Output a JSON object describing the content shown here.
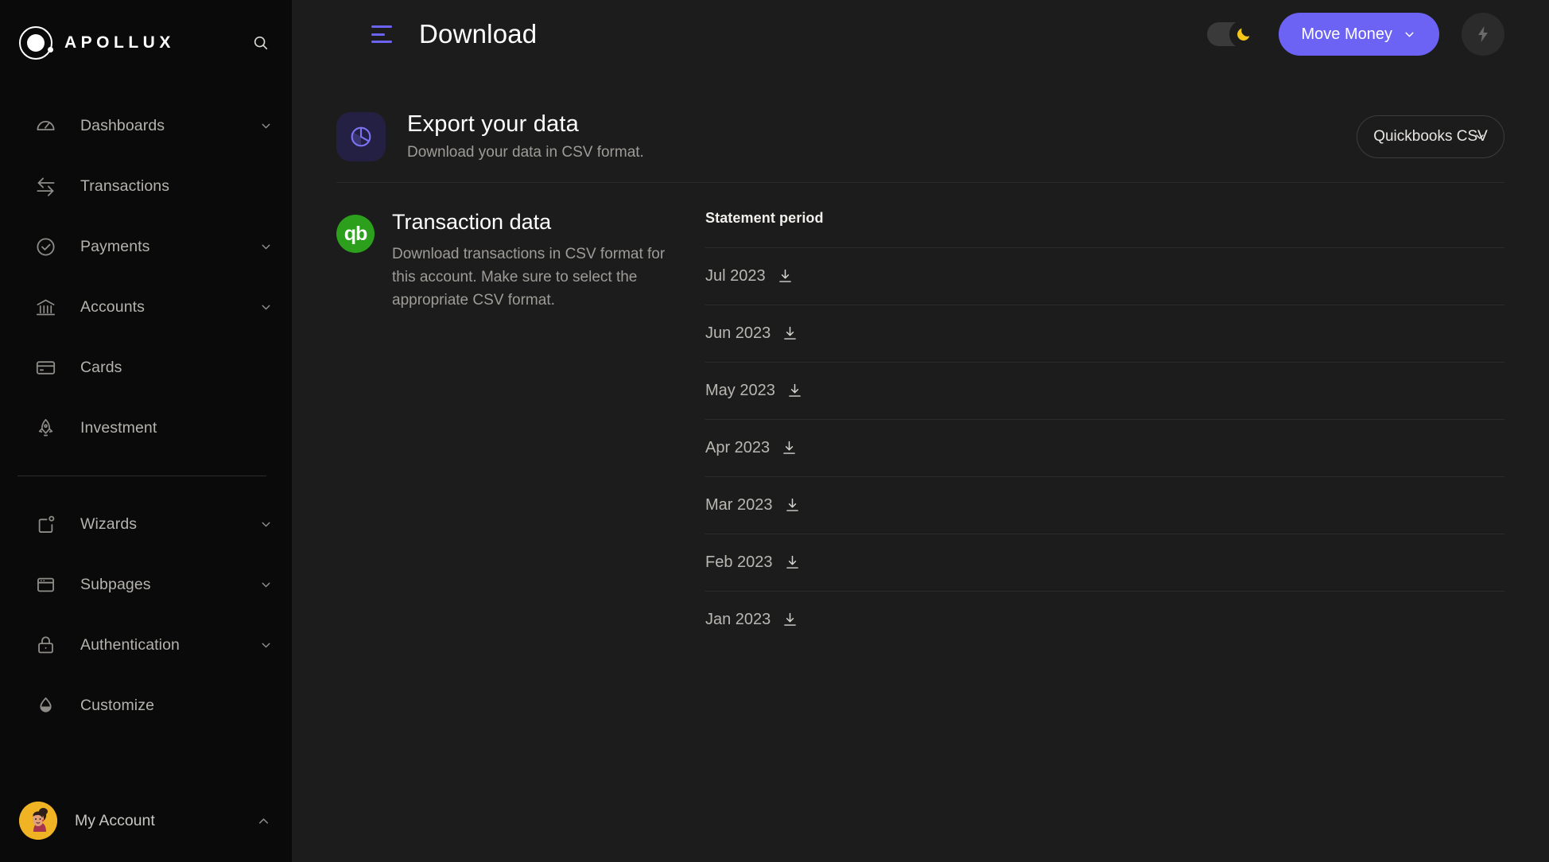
{
  "sidebar": {
    "brand": {
      "name": "APOLLUX",
      "logo_icon": "planet-orbit-icon"
    },
    "search_icon": "search-icon",
    "items": [
      {
        "label": "Dashboards",
        "icon": "gauge-icon",
        "has_chevron": true
      },
      {
        "label": "Transactions",
        "icon": "transfer-arrows-icon",
        "has_chevron": false
      },
      {
        "label": "Payments",
        "icon": "check-circle-icon",
        "has_chevron": true
      },
      {
        "label": "Accounts",
        "icon": "bank-icon",
        "has_chevron": true
      },
      {
        "label": "Cards",
        "icon": "credit-card-icon",
        "has_chevron": false
      },
      {
        "label": "Investment",
        "icon": "rocket-icon",
        "has_chevron": false
      }
    ],
    "items_secondary": [
      {
        "label": "Wizards",
        "icon": "wizard-box-icon",
        "has_chevron": true
      },
      {
        "label": "Subpages",
        "icon": "browser-window-icon",
        "has_chevron": true
      },
      {
        "label": "Authentication",
        "icon": "lock-icon",
        "has_chevron": true
      },
      {
        "label": "Customize",
        "icon": "droplet-icon",
        "has_chevron": false
      }
    ],
    "account": {
      "label": "My Account",
      "avatar_icon": "user-avatar",
      "chevron_icon": "chevron-up-icon"
    }
  },
  "topbar": {
    "menu_icon": "hamburger-menu-icon",
    "title": "Download",
    "theme_toggle": {
      "icon": "moon-icon",
      "state": "dark"
    },
    "move_money": {
      "label": "Move Money",
      "chevron_icon": "chevron-down-icon"
    },
    "quick_action": {
      "icon": "lightning-bolt-icon"
    }
  },
  "export": {
    "icon": "pie-chart-icon",
    "title": "Export your data",
    "subtitle": "Download your data in CSV format.",
    "format_select": {
      "value": "Quickbooks CSV",
      "chevron_icon": "chevron-down-icon"
    }
  },
  "transaction": {
    "icon": "quickbooks-logo",
    "icon_text": "qb",
    "title": "Transaction data",
    "description": "Download transactions in CSV format for this account. Make sure to select the appropriate CSV format.",
    "table": {
      "header": "Statement period",
      "rows": [
        {
          "period": "Jul 2023",
          "download_icon": "download-icon"
        },
        {
          "period": "Jun 2023",
          "download_icon": "download-icon"
        },
        {
          "period": "May 2023",
          "download_icon": "download-icon"
        },
        {
          "period": "Apr 2023",
          "download_icon": "download-icon"
        },
        {
          "period": "Mar 2023",
          "download_icon": "download-icon"
        },
        {
          "period": "Feb 2023",
          "download_icon": "download-icon"
        },
        {
          "period": "Jan 2023",
          "download_icon": "download-icon"
        }
      ]
    }
  },
  "colors": {
    "accent": "#6c63f5",
    "sidebar_bg": "#0a0a0a",
    "main_bg": "#1c1c1c",
    "quickbooks_green": "#2ca01c",
    "avatar_yellow": "#f0b323",
    "moon_yellow": "#f5c518"
  }
}
